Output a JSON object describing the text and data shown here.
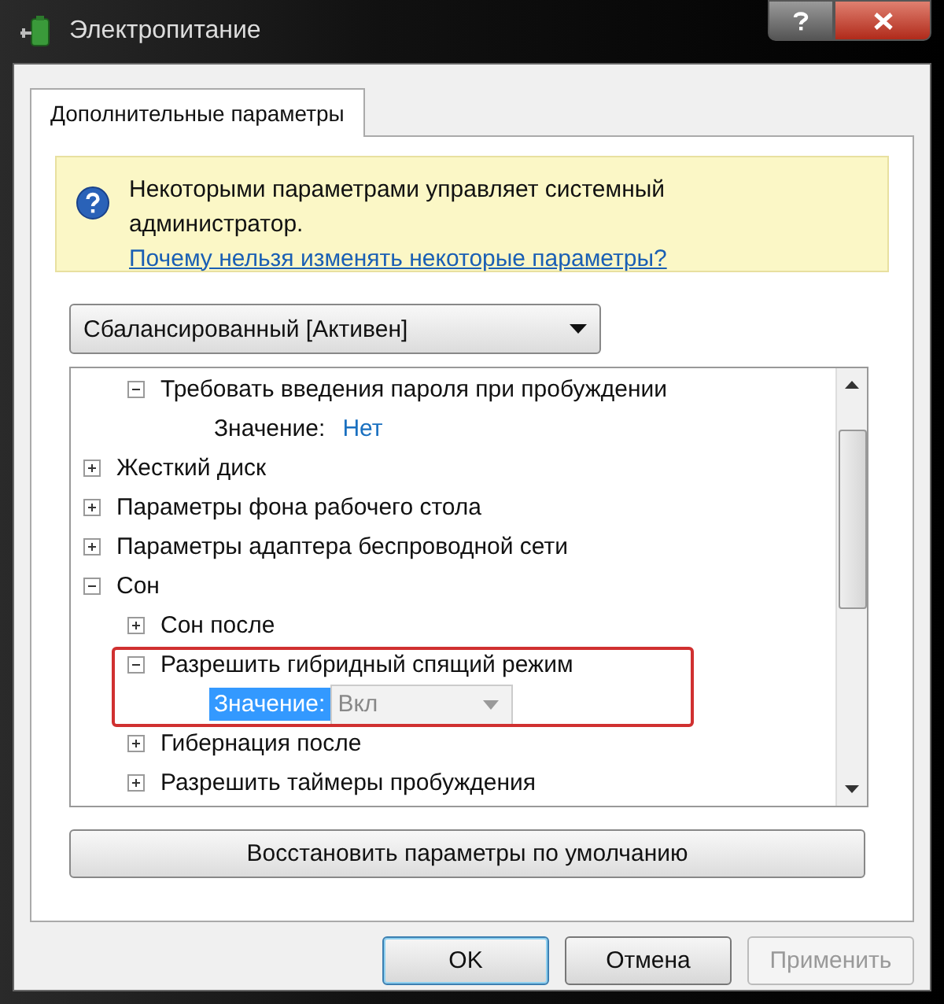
{
  "window": {
    "title": "Электропитание"
  },
  "tabs": [
    {
      "label": "Дополнительные параметры",
      "selected": true
    }
  ],
  "info": {
    "text": "Некоторыми параметрами управляет системный администратор.",
    "link": "Почему нельзя изменять некоторые параметры?"
  },
  "plan_select": {
    "value": "Сбалансированный [Активен]"
  },
  "tree": {
    "items": [
      {
        "children": [
          {
            "label": "Требовать введения пароля при пробуждении",
            "expanded": true,
            "value_label": "Значение:",
            "value": "Нет",
            "editing": false
          }
        ]
      },
      {
        "label": "Жесткий диск",
        "expanded": false
      },
      {
        "label": "Параметры фона рабочего стола",
        "expanded": false
      },
      {
        "label": "Параметры адаптера беспроводной сети",
        "expanded": false
      },
      {
        "label": "Сон",
        "expanded": true,
        "children": [
          {
            "label": "Сон после",
            "expanded": false
          },
          {
            "label": "Разрешить гибридный спящий режим",
            "expanded": true,
            "value_label": "Значение:",
            "value": "Вкл",
            "editing": true,
            "highlighted": true
          },
          {
            "label": "Гибернация после",
            "expanded": false
          },
          {
            "label": "Разрешить таймеры пробуждения",
            "expanded": false
          }
        ]
      }
    ]
  },
  "restore_button": "Восстановить параметры по умолчанию",
  "buttons": [
    {
      "label": "OK",
      "kind": "default",
      "disabled": false
    },
    {
      "label": "Отмена",
      "kind": "normal",
      "disabled": false
    },
    {
      "label": "Применить",
      "kind": "normal",
      "disabled": true
    }
  ]
}
